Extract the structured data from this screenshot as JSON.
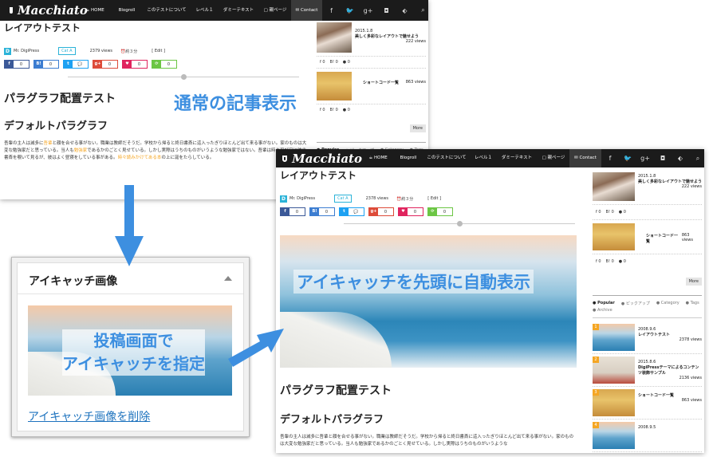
{
  "site": {
    "logo_text": "Macchiato",
    "nav_items": [
      "HOME",
      "Blogroll",
      "このテストについて",
      "レベル１",
      "ダミーテキスト",
      "親ページ",
      "Contact"
    ],
    "nav_icons": [
      "facebook-icon",
      "twitter-icon",
      "google-plus-icon",
      "instagram-icon",
      "feedly-icon",
      "search-icon"
    ],
    "nav_icon_glyphs": [
      "f",
      "🐦",
      "g+",
      "◘",
      "⬖",
      "⌕"
    ]
  },
  "post": {
    "title": "レイアウトテスト",
    "author": "Mr. DigiPress",
    "avatar_letter": "D",
    "category": "Cat A",
    "views_top": "2379 views",
    "views_bottom": "2378 views",
    "read_time": "約３分",
    "edit": "[ Edit ]",
    "share_buttons": [
      {
        "icon": "f",
        "count": "0",
        "color": "#3b5998"
      },
      {
        "icon": "B!",
        "count": "0",
        "color": "#3c7dd1"
      },
      {
        "icon": "t",
        "count": "💬",
        "color": "#1da1f2"
      },
      {
        "icon": "g+",
        "count": "0",
        "color": "#dd4b39"
      },
      {
        "icon": "♥",
        "count": "0",
        "color": "#e0245e"
      },
      {
        "icon": "⟳",
        "count": "0",
        "color": "#6cc644"
      }
    ],
    "heading1": "パラグラフ配置テスト",
    "heading2": "デフォルトパラグラフ",
    "para_top_1": "吾輩の主人は滅多に",
    "para_top_hl1": "吾輩",
    "para_top_2": "と顔を合せる事がない。職業は教師だそうだ。学校から帰ると終日書斎に這入ったぎりほとんど出て来る事がない。家のものは大変な勉強家だと思っている。当人も",
    "para_top_hl2": "勉強家",
    "para_top_3": "であるかのごとく見せている。しかし実際はうちのものがいうような勉強家ではない。吾輩は時々忍び足に彼の書斎を覗いて見るが、彼はよく昼寝をしている事がある。",
    "para_top_hl3": "時々読みかけてある本",
    "para_top_4": "の上に涎をたらしている。",
    "para_bottom": "吾輩の主人は滅多に吾輩と顔を合せる事がない。職業は教師だそうだ。学校から帰ると終日書斎に這入ったぎりほとんど出て来る事がない。家のものは大変な勉強家だと思っている。当人も勉強家であるかのごとく見せている。しかし実際はうちのものがいうような"
  },
  "sidebar": {
    "popular": [
      {
        "date": "2015.1.8",
        "title": "美しく多彩なレイアウトで魅せよう",
        "views": "222 views",
        "stats": [
          "0",
          "0",
          "0"
        ]
      },
      {
        "date": "",
        "title": "ショートコード一覧",
        "views": "863 views",
        "stats": [
          "0",
          "0",
          "0"
        ]
      }
    ],
    "more_label": "More",
    "tabs": [
      "Popular",
      "ピックアップ",
      "Category",
      "Tags",
      "Archive"
    ],
    "ranked": [
      {
        "rank": "1",
        "date": "2008.9.6",
        "title": "レイアウトテスト",
        "views": "2378 views"
      },
      {
        "rank": "2",
        "date": "2015.8.6",
        "title": "DigiPressテーマによるコンテンツ装飾サンプル",
        "views": "2136 views"
      },
      {
        "rank": "3",
        "date": "",
        "title": "ショートコード一覧",
        "views": "863 views"
      },
      {
        "rank": "4",
        "date": "2008.9.5",
        "title": "",
        "views": ""
      }
    ]
  },
  "callouts": {
    "normal": "通常の記事表示",
    "auto": "アイキャッチを先頭に自動表示",
    "set_line1": "投稿画面で",
    "set_line2": "アイキャッチを指定"
  },
  "panel": {
    "title": "アイキャッチ画像",
    "remove_link": "アイキャッチ画像を削除"
  }
}
